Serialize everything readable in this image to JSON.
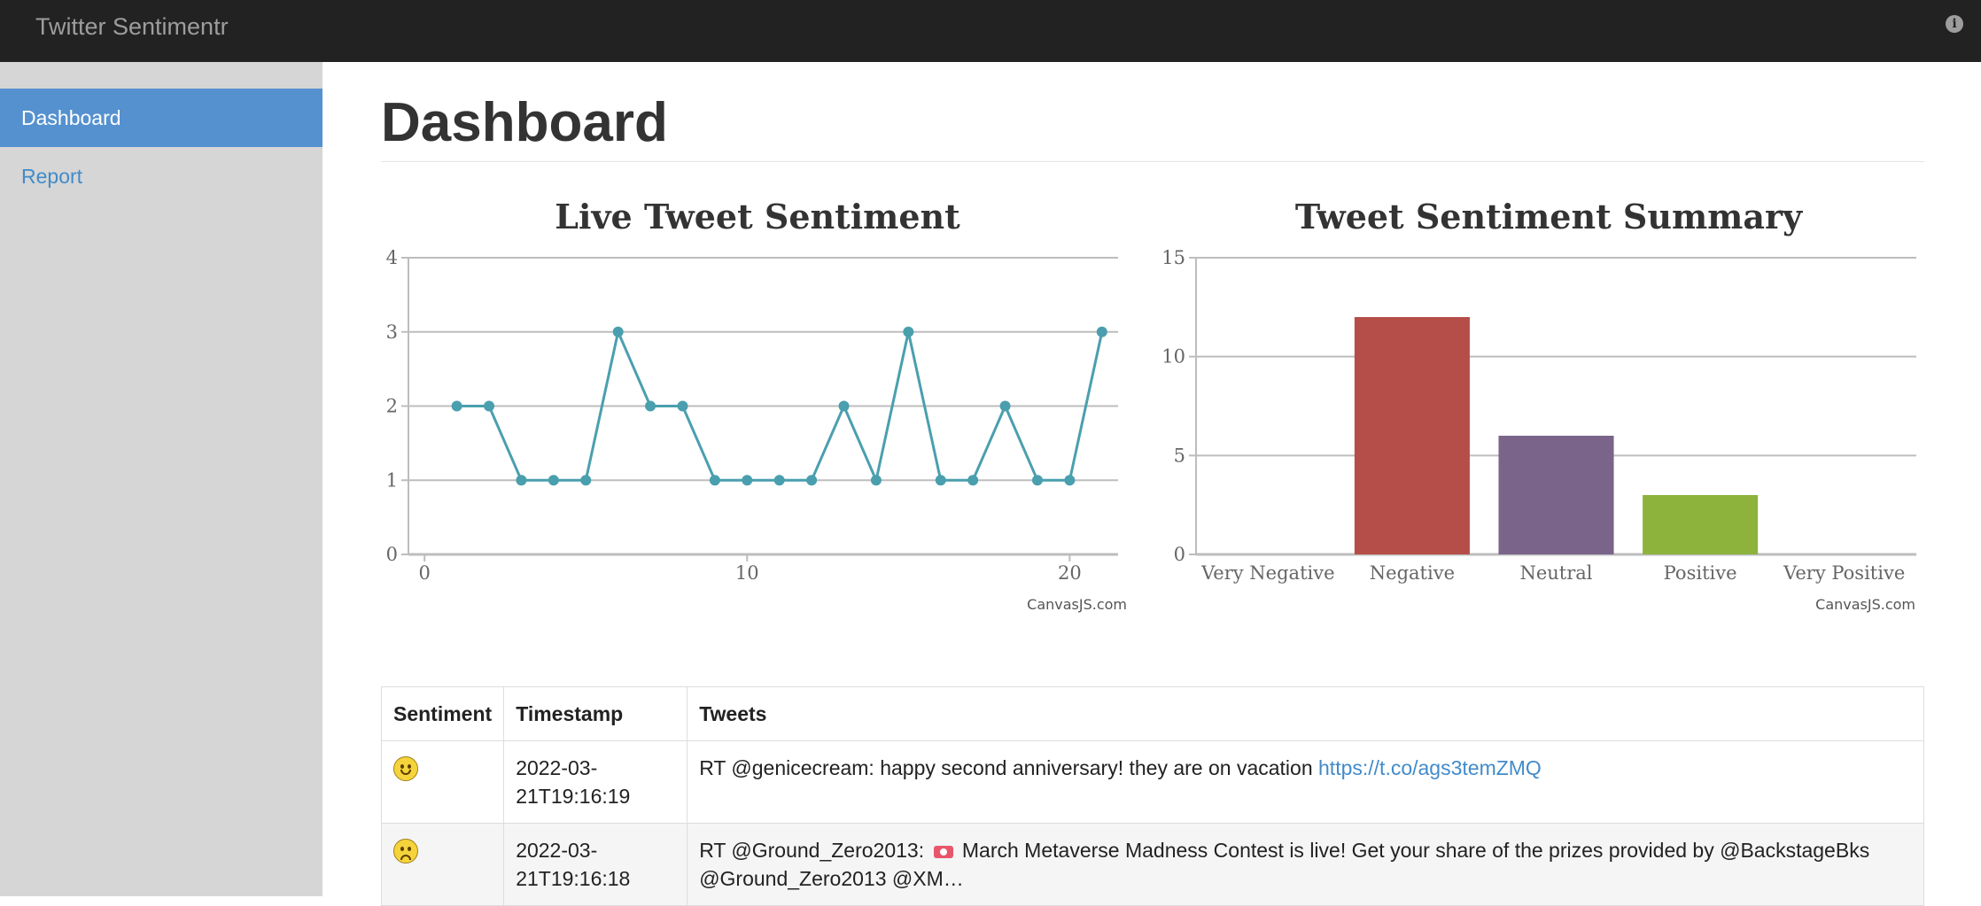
{
  "app": {
    "brand": "Twitter Sentimentr"
  },
  "header": {
    "info_icon": "info-icon"
  },
  "sidebar": {
    "items": [
      {
        "label": "Dashboard",
        "active": true
      },
      {
        "label": "Report",
        "active": false
      }
    ]
  },
  "main": {
    "title": "Dashboard"
  },
  "charts": {
    "live": {
      "credit": "CanvasJS.com"
    },
    "summary": {
      "credit": "CanvasJS.com"
    }
  },
  "chart_data": [
    {
      "type": "line",
      "title": "Live Tweet Sentiment",
      "xlim": [
        -0.5,
        21.5
      ],
      "ylim": [
        0,
        4
      ],
      "x_ticks": [
        0,
        10,
        20
      ],
      "y_ticks": [
        0,
        1,
        2,
        3,
        4
      ],
      "grid": true,
      "color": "#4a9fae",
      "x": [
        1,
        2,
        3,
        4,
        5,
        6,
        7,
        8,
        9,
        10,
        11,
        12,
        13,
        14,
        15,
        16,
        17,
        18,
        19,
        20,
        21
      ],
      "values": [
        2,
        2,
        1,
        1,
        1,
        3,
        2,
        2,
        1,
        1,
        1,
        1,
        2,
        1,
        3,
        1,
        1,
        2,
        1,
        1,
        3
      ]
    },
    {
      "type": "bar",
      "title": "Tweet Sentiment Summary",
      "categories": [
        "Very Negative",
        "Negative",
        "Neutral",
        "Positive",
        "Very Positive"
      ],
      "values": [
        0,
        12,
        6,
        3,
        0
      ],
      "ylim": [
        0,
        15
      ],
      "y_ticks": [
        0,
        5,
        10,
        15
      ],
      "grid": true,
      "colors": [
        "#4f81bc",
        "#b54e48",
        "#7b6489",
        "#8db33c",
        "#4bacc6"
      ]
    }
  ],
  "table": {
    "headers": {
      "sentiment": "Sentiment",
      "timestamp": "Timestamp",
      "tweets": "Tweets"
    },
    "rows": [
      {
        "sentiment_icon": "smiley-face-icon",
        "timestamp_line1": "2022-03-",
        "timestamp_line2": "21T19:16:19",
        "tweet_text": "RT @genicecream: happy second anniversary! they are on vacation ",
        "tweet_link": "https://t.co/ags3temZMQ"
      },
      {
        "sentiment_icon": "frowning-face-icon",
        "timestamp_line1": "2022-03-",
        "timestamp_line2": "21T19:16:18",
        "tweet_prefix": "RT @Ground_Zero2013: ",
        "tweet_emoji": "ticket-emoji-icon",
        "tweet_line1_rest": " March Metaverse Madness Contest is live! Get your share of the prizes provided by @BackstageBks",
        "tweet_line2": "@Ground_Zero2013 @XM…"
      }
    ]
  }
}
